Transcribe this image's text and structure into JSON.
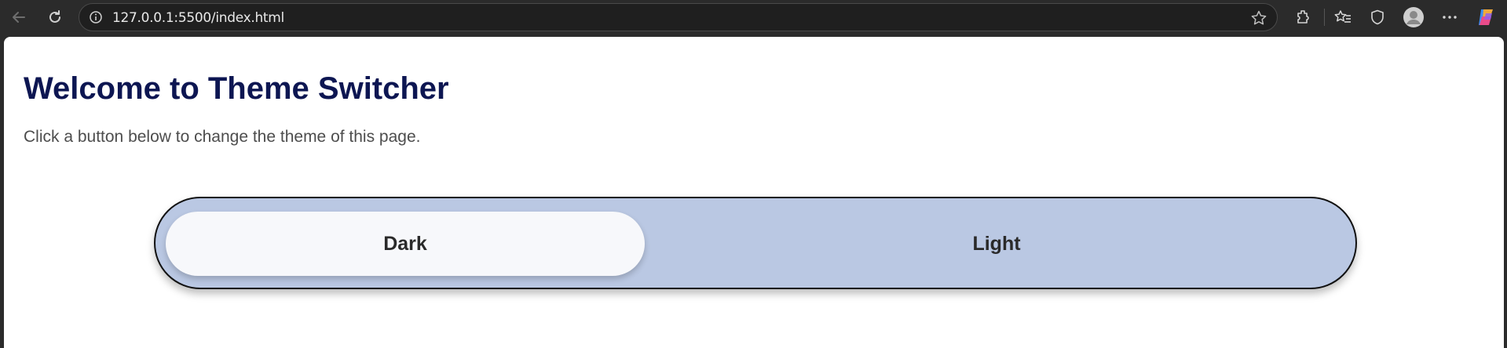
{
  "browser": {
    "url": "127.0.0.1:5500/index.html",
    "icons": [
      "back-arrow-icon",
      "reload-icon",
      "info-icon",
      "star-icon",
      "extensions-icon",
      "favorites-icon",
      "shield-icon",
      "profile-avatar-icon",
      "more-icon",
      "copilot-icon"
    ]
  },
  "page": {
    "title": "Welcome to Theme Switcher",
    "description": "Click a button below to change the theme of this page."
  },
  "switcher": {
    "options": [
      {
        "label": "Dark",
        "selected": true
      },
      {
        "label": "Light",
        "selected": false
      }
    ]
  },
  "colors": {
    "title": "#0d1652",
    "switcher_bg": "#bac8e3",
    "selected_bg": "#f7f8fb",
    "browser_chrome": "#2b2b2b"
  }
}
